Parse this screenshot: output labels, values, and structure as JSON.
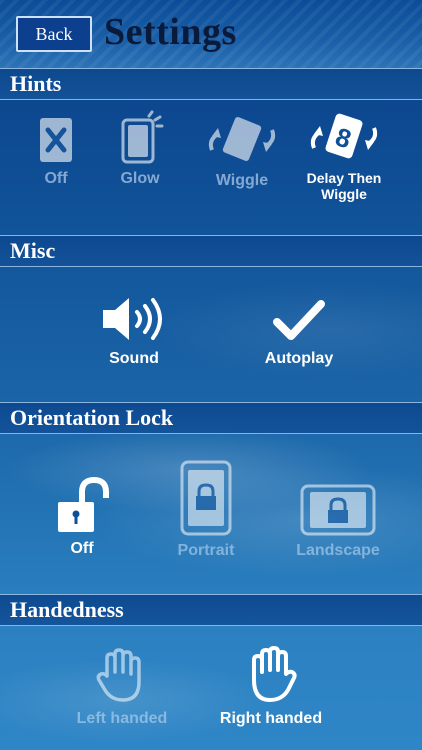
{
  "header": {
    "back_label": "Back",
    "title": "Settings"
  },
  "hints": {
    "section_title": "Hints",
    "options": [
      {
        "label": "Off",
        "icon": "x-card-icon",
        "selected": false
      },
      {
        "label": "Glow",
        "icon": "glow-card-icon",
        "selected": false
      },
      {
        "label": "Wiggle",
        "icon": "wiggle-card-icon",
        "selected": false
      },
      {
        "label": "Delay Then Wiggle",
        "icon": "delay-wiggle-icon",
        "selected": true
      }
    ]
  },
  "misc": {
    "section_title": "Misc",
    "options": [
      {
        "label": "Sound",
        "icon": "speaker-icon",
        "selected": true
      },
      {
        "label": "Autoplay",
        "icon": "checkmark-icon",
        "selected": true
      }
    ]
  },
  "orientation": {
    "section_title": "Orientation Lock",
    "options": [
      {
        "label": "Off",
        "icon": "unlocked-padlock-icon",
        "selected": true
      },
      {
        "label": "Portrait",
        "icon": "portrait-lock-icon",
        "selected": false
      },
      {
        "label": "Landscape",
        "icon": "landscape-lock-icon",
        "selected": false
      }
    ]
  },
  "handedness": {
    "section_title": "Handedness",
    "options": [
      {
        "label": "Left handed",
        "icon": "left-hand-icon",
        "selected": false
      },
      {
        "label": "Right handed",
        "icon": "right-hand-icon",
        "selected": true
      }
    ]
  }
}
